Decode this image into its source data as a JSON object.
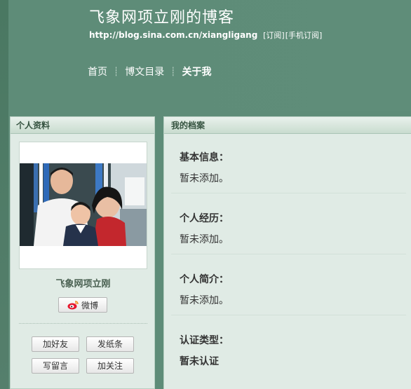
{
  "header": {
    "title": "飞象网项立刚的博客",
    "url": "http://blog.sina.com.cn/xiangligang",
    "subscribe_label": "[订阅]",
    "mobile_subscribe_label": "[手机订阅]"
  },
  "nav": {
    "items": [
      {
        "label": "首页"
      },
      {
        "label": "博文目录"
      },
      {
        "label": "关于我"
      }
    ],
    "active_label": "关于我"
  },
  "left_panel": {
    "title": "个人资料",
    "profile_name": "飞象网项立刚",
    "weibo_label": "微博",
    "buttons": {
      "add_friend": "加好友",
      "send_note": "发纸条",
      "leave_message": "写留言",
      "follow": "加关注"
    }
  },
  "right_panel": {
    "title": "我的档案",
    "sections": [
      {
        "label": "基本信息：",
        "value": "暂未添加。"
      },
      {
        "label": "个人经历：",
        "value": "暂未添加。"
      },
      {
        "label": "个人简介：",
        "value": "暂未添加。"
      },
      {
        "label": "认证类型：",
        "value": "暂未认证"
      }
    ]
  },
  "colors": {
    "background": "#5e8c78",
    "panel_bg": "#e0ebe5",
    "header_text": "#ffffff",
    "panel_title": "#34523f"
  }
}
